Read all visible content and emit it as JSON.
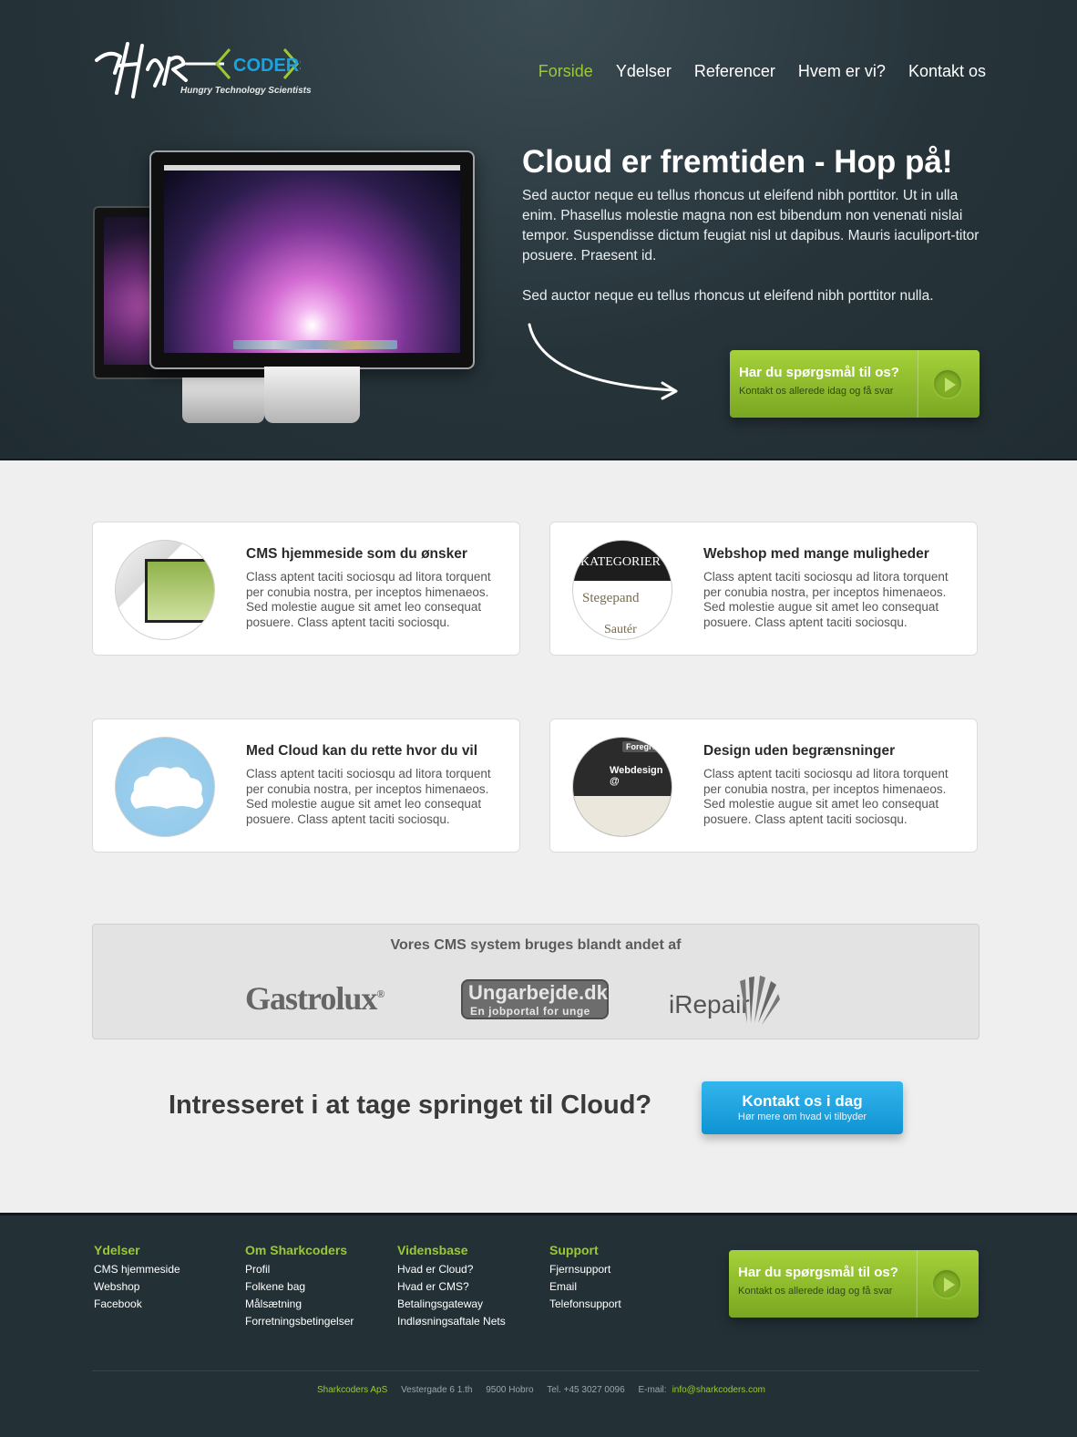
{
  "brand": {
    "logo_text_left": "SHAR",
    "logo_text_right": "CODERS",
    "tagline": "Hungry Technology Scientists",
    "colors": {
      "green": "#9bc934",
      "blue": "#1ba3e0",
      "dark": "#26343a"
    }
  },
  "nav": [
    {
      "label": "Forside",
      "active": true
    },
    {
      "label": "Ydelser",
      "active": false
    },
    {
      "label": "Referencer",
      "active": false
    },
    {
      "label": "Hvem er vi?",
      "active": false
    },
    {
      "label": "Kontakt os",
      "active": false
    }
  ],
  "hero": {
    "title": "Cloud er fremtiden - Hop på!",
    "text": "Sed auctor neque eu tellus rhoncus ut eleifend nibh porttitor. Ut in ulla enim. Phasellus molestie magna non est bibendum non venenati nislai tempor. Suspendisse dictum feugiat nisl ut dapibus. Mauris iaculiport-titor posuere. Praesent id.",
    "text2": "Sed auctor neque eu tellus rhoncus ut eleifend nibh porttitor nulla.",
    "cta": {
      "title": "Har du spørgsmål til os?",
      "subtitle": "Kontakt os allerede idag og få svar"
    }
  },
  "features": [
    {
      "title": "CMS hjemmeside som du ønsker",
      "text": "Class aptent taciti sociosqu ad litora torquent per conubia nostra, per inceptos himenaeos. Sed molestie augue sit amet leo consequat posuere. Class aptent taciti sociosqu.",
      "icon": "cms-thumbnail"
    },
    {
      "title": "Webshop med mange muligheder",
      "text": "Class aptent taciti sociosqu ad litora torquent per conubia nostra, per inceptos himenaeos. Sed molestie augue sit amet leo consequat posuere. Class aptent taciti sociosqu.",
      "icon": "webshop-thumbnail",
      "thumb_lines": [
        "KATEGORIER",
        "Stegepand",
        "Sautér"
      ]
    },
    {
      "title": "Med Cloud kan du rette hvor du vil",
      "text": "Class aptent taciti sociosqu ad litora torquent per conubia nostra, per inceptos himenaeos. Sed molestie augue sit amet leo consequat posuere. Class aptent taciti sociosqu.",
      "icon": "cloud-icon"
    },
    {
      "title": "Design uden begrænsninger",
      "text": "Class aptent taciti sociosqu ad litora torquent per conubia nostra, per inceptos himenaeos. Sed molestie augue sit amet leo consequat posuere. Class aptent taciti sociosqu.",
      "icon": "design-thumbnail",
      "thumb_lines": [
        "Foregro",
        "Webdesign @"
      ]
    }
  ],
  "clients": {
    "heading": "Vores CMS system bruges blandt andet af",
    "logos": {
      "gastrolux": "Gastrolux",
      "gastrolux_mark": "®",
      "ungarbejde": "Ungarbejde.dk",
      "ungarbejde_sub": "En jobportal for unge",
      "irepair": "iRepair"
    }
  },
  "cta_row": {
    "title": "Intresseret i at tage springet til Cloud?",
    "button_title": "Kontakt os i dag",
    "button_subtitle": "Hør mere om hvad vi tilbyder"
  },
  "footer": {
    "columns": [
      {
        "heading": "Ydelser",
        "links": [
          "CMS hjemmeside",
          "Webshop",
          "Facebook"
        ]
      },
      {
        "heading": "Om Sharkcoders",
        "links": [
          "Profil",
          "Folkene bag",
          "Målsætning",
          "Forretningsbetingelser"
        ]
      },
      {
        "heading": "Vidensbase",
        "links": [
          "Hvad er Cloud?",
          "Hvad er CMS?",
          "Betalingsgateway",
          "Indløsningsaftale Nets"
        ]
      },
      {
        "heading": "Support",
        "links": [
          "Fjernsupport",
          "Email",
          "Telefonsupport"
        ]
      }
    ],
    "cta": {
      "title": "Har du spørgsmål til os?",
      "subtitle": "Kontakt os allerede idag og få svar"
    },
    "bottom": {
      "company": "Sharkcoders ApS",
      "address": "Vestergade 6 1.th",
      "city": "9500 Hobro",
      "phone": "Tel. +45 3027 0096",
      "email_label": "E-mail:",
      "email": "info@sharkcoders.com"
    }
  }
}
